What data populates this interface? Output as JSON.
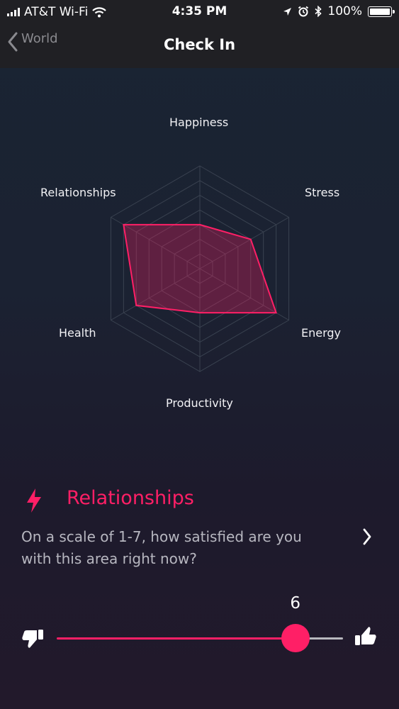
{
  "status_bar": {
    "carrier": "AT&T Wi-Fi",
    "time": "4:35 PM",
    "battery": "100%"
  },
  "nav": {
    "back_label": "World",
    "title": "Check In"
  },
  "chart_data": {
    "type": "radar",
    "axes": [
      "Happiness",
      "Stress",
      "Energy",
      "Productivity",
      "Health",
      "Relationships"
    ],
    "scale": [
      0,
      7
    ],
    "values": [
      3,
      4,
      6,
      3,
      5,
      6
    ],
    "color": "#ff1f66"
  },
  "question": {
    "category": "Relationships",
    "text": "On a scale of 1-7, how satisfied are you with this area right now?"
  },
  "slider": {
    "min": 1,
    "max": 7,
    "value": 6,
    "value_label": "6"
  },
  "colors": {
    "accent": "#ff1f66",
    "nav_background": "#202024"
  },
  "icons": {
    "back": "chevron-left-icon",
    "next": "chevron-right-icon",
    "category": "lightning-bolt-icon",
    "dislike": "thumbs-down-icon",
    "like": "thumbs-up-icon"
  }
}
